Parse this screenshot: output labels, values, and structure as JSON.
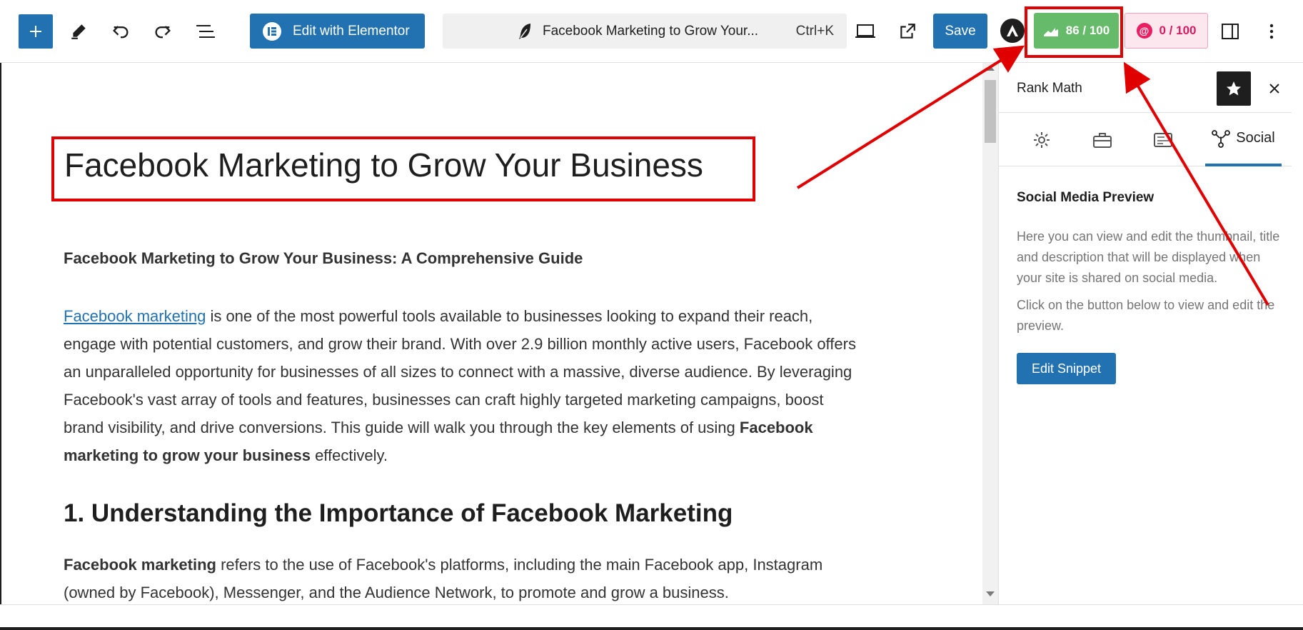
{
  "toolbar": {
    "add_icon": "plus-icon",
    "tools_icon": "pencil-icon",
    "undo_icon": "undo-icon",
    "redo_icon": "redo-icon",
    "list_view_icon": "list-view-icon",
    "elementor_label": "Edit with Elementor",
    "document_title": "Facebook Marketing to Grow Your...",
    "shortcut": "Ctrl+K",
    "preview_icon": "laptop-icon",
    "view_post_icon": "external-link-icon",
    "save_label": "Save",
    "seo_score": "86 / 100",
    "content_ai_score": "0 / 100",
    "settings_toggle_icon": "sidebar-icon",
    "options_icon": "kebab-menu-icon"
  },
  "editor": {
    "post_title": "Facebook Marketing to Grow Your Business",
    "subtitle": "Facebook Marketing to Grow Your Business: A Comprehensive Guide",
    "para1_link": "Facebook marketing",
    "para1_text": " is one of the most powerful tools available to businesses looking to expand their reach, engage with potential customers, and grow their brand. With over 2.9 billion monthly active users, Facebook offers an unparalleled opportunity for businesses of all sizes to connect with a massive, diverse audience. By leveraging Facebook's vast array of tools and features, businesses can craft highly targeted marketing campaigns, boost brand visibility, and drive conversions. This guide will walk you through the key elements of using ",
    "para1_bold": "Facebook marketing to grow your business",
    "para1_end": " effectively.",
    "section_heading": "1. Understanding the Importance of Facebook Marketing",
    "para2_bold": "Facebook marketing",
    "para2_text": " refers to the use of Facebook's platforms, including the main Facebook app, Instagram (owned by Facebook), Messenger, and the Audience Network, to promote and grow a business."
  },
  "panel": {
    "title": "Rank Math",
    "tabs": [
      {
        "icon": "gear-icon",
        "label": ""
      },
      {
        "icon": "briefcase-icon",
        "label": ""
      },
      {
        "icon": "schema-icon",
        "label": ""
      },
      {
        "icon": "social-icon",
        "label": "Social"
      }
    ],
    "section_title": "Social Media Preview",
    "description1": "Here you can view and edit the thumbnail, title and description that will be displayed when your site is shared on social media.",
    "description2": "Click on the button below to view and edit the preview.",
    "edit_snippet_label": "Edit Snippet"
  },
  "colors": {
    "wp_blue": "#2271b1",
    "seo_green": "#66bb6a",
    "content_pink": "#d81b60",
    "annotation_red": "#e00000"
  }
}
